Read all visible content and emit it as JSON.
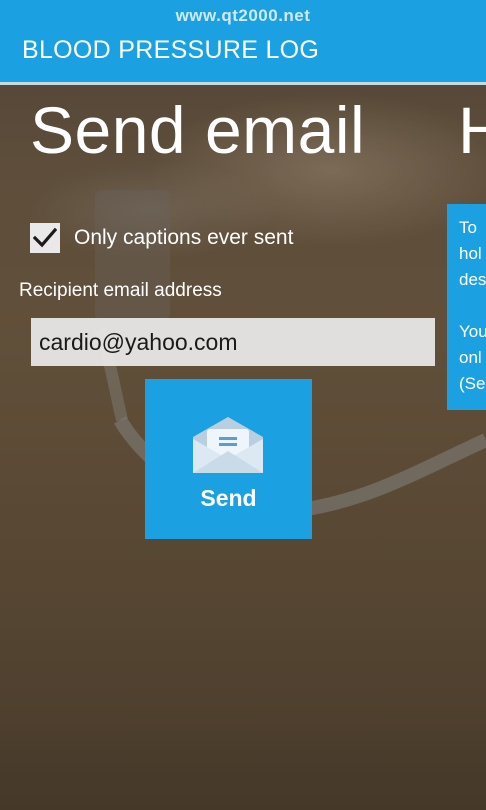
{
  "watermark": "www.qt2000.net",
  "app_title": "BLOOD PRESSURE LOG",
  "pivot": {
    "current": "Send email",
    "next": "H"
  },
  "captions_checkbox": {
    "label": "Only captions ever sent",
    "checked": true
  },
  "recipient": {
    "label": "Recipient email address",
    "value": "cardio@yahoo.com"
  },
  "send_button": {
    "label": "Send",
    "icon": "envelope-icon"
  },
  "help_panel": {
    "lines": [
      "To",
      "hol",
      "des",
      "",
      "You",
      "onl",
      "(Se"
    ]
  },
  "colors": {
    "accent": "#1ba1e2",
    "text": "#ffffff"
  }
}
